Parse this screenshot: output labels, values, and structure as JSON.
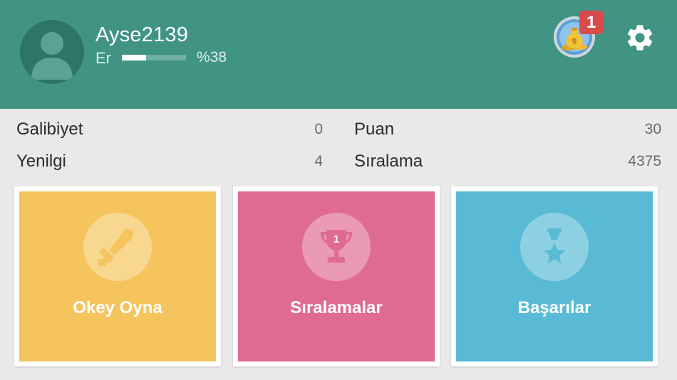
{
  "header": {
    "username": "Ayse2139",
    "rank": "Er",
    "progress_text": "%38",
    "progress_value": 0.38,
    "notification_count": "1",
    "avatar_icon": "user-silhouette-icon",
    "coin_icon": "money-bag-coins-icon",
    "settings_icon": "gear-icon",
    "background_color": "#419484"
  },
  "stats": {
    "wins_label": "Galibiyet",
    "wins_value": "0",
    "losses_label": "Yenilgi",
    "losses_value": "4",
    "points_label": "Puan",
    "points_value": "30",
    "ranking_label": "Sıralama",
    "ranking_value": "4375"
  },
  "cards": [
    {
      "label": "Okey Oyna",
      "icon": "sword-icon",
      "color": "#f5c45c"
    },
    {
      "label": "Sıralamalar",
      "icon": "trophy-icon",
      "color": "#e06b91"
    },
    {
      "label": "Başarılar",
      "icon": "star-medal-icon",
      "color": "#58bad5"
    }
  ]
}
